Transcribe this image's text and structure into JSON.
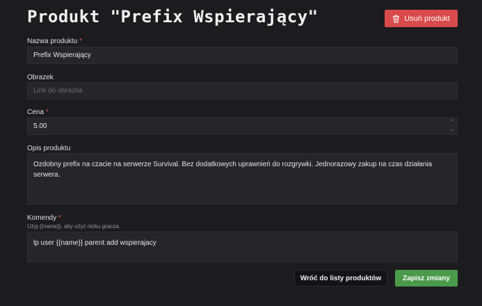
{
  "header": {
    "title": "Produkt \"Prefix Wspierający\"",
    "delete_label": "Usuń produkt"
  },
  "form": {
    "name": {
      "label": "Nazwa produktu",
      "required_mark": "*",
      "value": "Prefix Wspierający"
    },
    "image": {
      "label": "Obrazek",
      "placeholder": "Link do obrazka",
      "value": ""
    },
    "price": {
      "label": "Cena",
      "required_mark": "*",
      "value": "5.00"
    },
    "description": {
      "label": "Opis produktu",
      "value": "Ozdobny prefix na czacie na serwerze Survival. Bez dodatkowych uprawnień do rozgrywki. Jednorazowy zakup na czas działania serwera."
    },
    "commands": {
      "label": "Komendy",
      "required_mark": "*",
      "hint": "Użyj {{name}}, aby użyć nicku gracza.",
      "value": "lp user {{name}} parent add wspierajacy"
    }
  },
  "actions": {
    "back_label": "Wróć do listy produktów",
    "save_label": "Zapisz zmiany"
  },
  "colors": {
    "background": "#1c1c1f",
    "danger": "#d94a4a",
    "success": "#4a9a4a",
    "required": "#e05555"
  },
  "icons": {
    "delete": "trash-icon",
    "spinner_up": "chevron-up-icon",
    "spinner_down": "chevron-down-icon"
  }
}
